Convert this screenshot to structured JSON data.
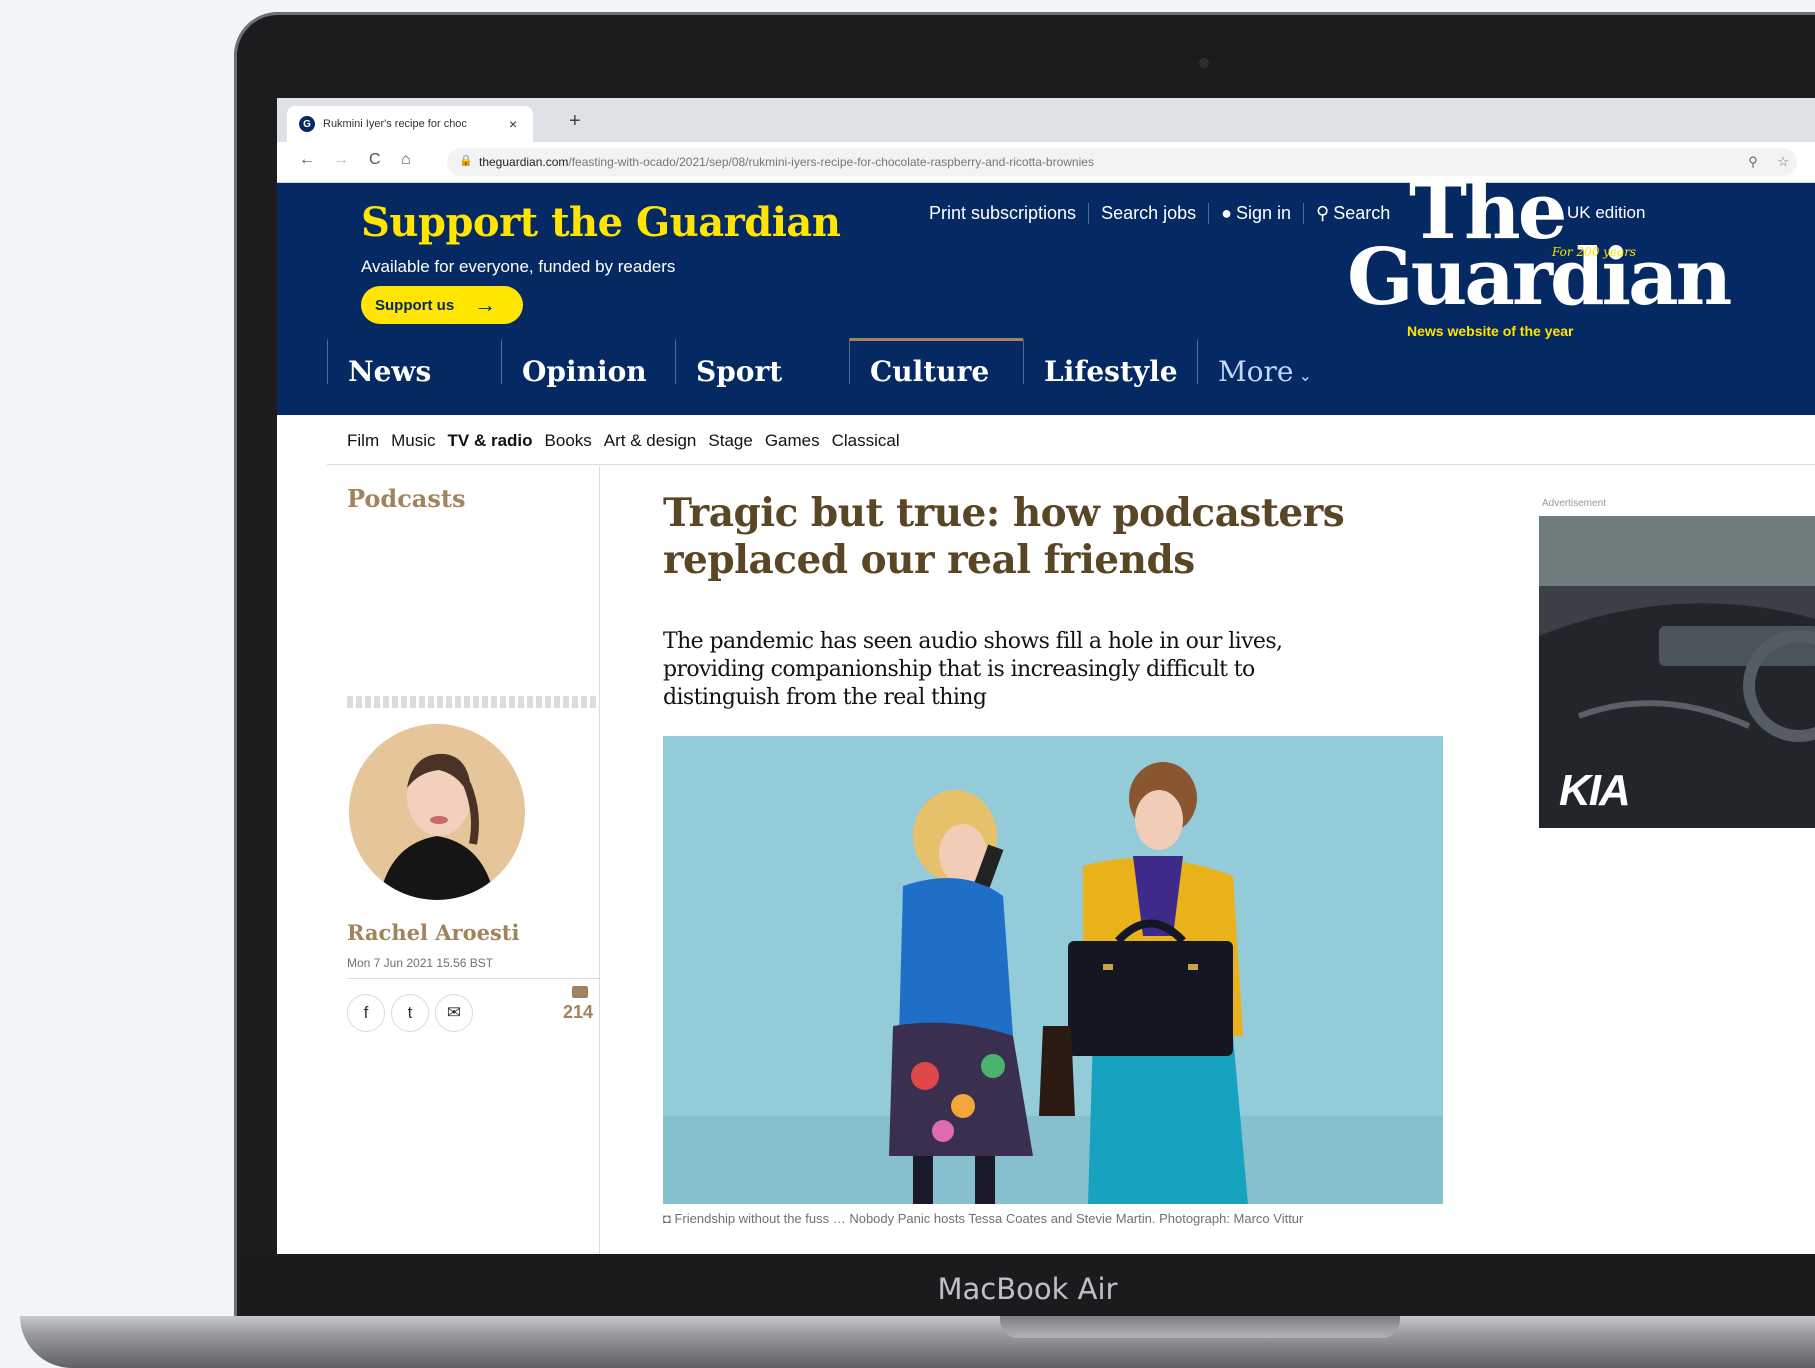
{
  "device": {
    "label": "MacBook Air"
  },
  "browser": {
    "tab_title": "Rukmini Iyer's recipe for choc",
    "tab_close": "×",
    "new_tab": "+",
    "nav": {
      "back": "←",
      "forward": "→",
      "reload": "C",
      "home": "⌂"
    },
    "url_domain": "theguardian.com",
    "url_path": "/feasting-with-ocado/2021/sep/08/rukmini-iyers-recipe-for-chocolate-raspberry-and-ricotta-brownies"
  },
  "header": {
    "support_title": "Support the Guardian",
    "support_sub": "Available for everyone, funded by readers",
    "support_button": "Support us",
    "links": [
      "Print subscriptions",
      "Search jobs",
      "Sign in",
      "Search"
    ],
    "edition": "UK edition",
    "logo_line1": "The",
    "logo_line2": "Guardian",
    "logo_tagline": "News website of the year",
    "logo_years": "For 200 years",
    "accent": "#ffe500",
    "brand": "#052962"
  },
  "pillars": [
    {
      "label": "News"
    },
    {
      "label": "Opinion"
    },
    {
      "label": "Sport"
    },
    {
      "label": "Culture"
    },
    {
      "label": "Lifestyle"
    },
    {
      "label": "More"
    }
  ],
  "subnav": [
    "Film",
    "Music",
    "TV & radio",
    "Books",
    "Art & design",
    "Stage",
    "Games",
    "Classical"
  ],
  "article": {
    "section": "Podcasts",
    "headline": "Tragic but true: how podcasters replaced our real friends",
    "standfirst": "The pandemic has seen audio shows fill a hole in our lives, providing companionship that is increasingly difficult to distinguish from the real thing",
    "author": "Rachel Aroesti",
    "date": "Mon 7 Jun 2021 15.56 BST",
    "comments": "214",
    "caption": "Friendship without the fuss … Nobody Panic hosts Tessa Coates and Stevie Martin. Photograph: Marco Vittur",
    "share": {
      "facebook": "f",
      "twitter": "t",
      "email": "✉"
    }
  },
  "ad": {
    "label": "Advertisement",
    "brand": "KIA"
  }
}
